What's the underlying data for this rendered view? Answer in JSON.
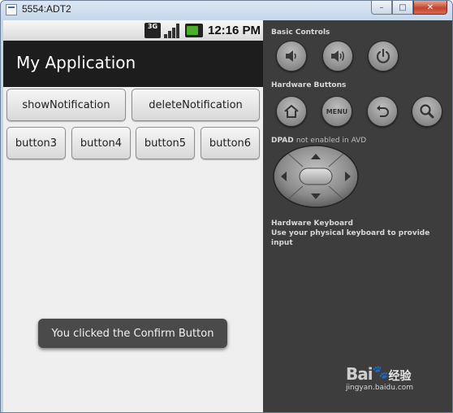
{
  "window": {
    "title": "5554:ADT2",
    "minimize_glyph": "–",
    "maximize_glyph": "□",
    "close_glyph": "✕"
  },
  "statusbar": {
    "network_label": "3G",
    "time": "12:16 PM"
  },
  "app": {
    "title": "My Application",
    "buttons": {
      "show": "showNotification",
      "delete": "deleteNotification",
      "b3": "button3",
      "b4": "button4",
      "b5": "button5",
      "b6": "button6"
    },
    "toast": "You clicked the Confirm Button"
  },
  "panel": {
    "basic_controls_label": "Basic Controls",
    "hardware_buttons_label": "Hardware Buttons",
    "menu_label": "MENU",
    "dpad_label": "DPAD",
    "dpad_note": "not enabled in AVD",
    "keyboard_label": "Hardware Keyboard",
    "keyboard_note": "Use your physical keyboard to provide input"
  },
  "watermark": {
    "logo": "Bai",
    "logo_suffix": "经验",
    "url": "jingyan.baidu.com"
  },
  "colors": {
    "screen_bg": "#efefef",
    "action_bar": "#1d1d1d",
    "panel_bg": "#3d3d3d",
    "toast_bg": "#4a4a4a"
  }
}
